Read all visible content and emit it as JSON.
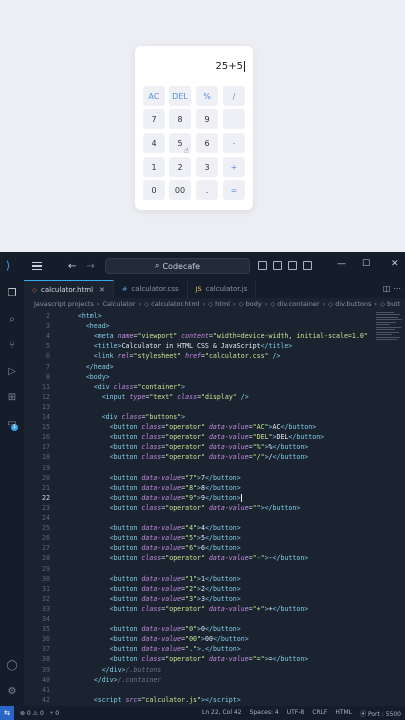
{
  "preview": {
    "display_value": "25+5",
    "buttons": [
      {
        "label": "AC",
        "op": true
      },
      {
        "label": "DEL",
        "op": true
      },
      {
        "label": "%",
        "op": true
      },
      {
        "label": "/",
        "op": true
      },
      {
        "label": "7",
        "op": false
      },
      {
        "label": "8",
        "op": false
      },
      {
        "label": "9",
        "op": false
      },
      {
        "label": "",
        "op": true
      },
      {
        "label": "4",
        "op": false
      },
      {
        "label": "5",
        "op": false
      },
      {
        "label": "6",
        "op": false
      },
      {
        "label": "-",
        "op": true
      },
      {
        "label": "1",
        "op": false
      },
      {
        "label": "2",
        "op": false
      },
      {
        "label": "3",
        "op": false
      },
      {
        "label": "+",
        "op": true
      },
      {
        "label": "0",
        "op": false
      },
      {
        "label": "00",
        "op": false
      },
      {
        "label": ".",
        "op": false
      },
      {
        "label": "=",
        "op": true
      }
    ]
  },
  "titlebar": {
    "search_text": "Codecafe",
    "minimize": "—",
    "maximize": "☐",
    "close": "✕"
  },
  "tabs": [
    {
      "label": "calculator.html",
      "icon": "◇",
      "kind": "html",
      "active": true
    },
    {
      "label": "calculator.css",
      "icon": "#",
      "kind": "css",
      "active": false
    },
    {
      "label": "calculator.js",
      "icon": "JS",
      "kind": "js",
      "active": false
    }
  ],
  "breadcrumb": [
    "Javascript projects",
    "›",
    "Calculator",
    "›",
    "◇ calculator.html",
    "›",
    "◇ html",
    "›",
    "◇ body",
    "›",
    "◇ div.container",
    "›",
    "◇ div.buttons",
    "›",
    "◇ butt"
  ],
  "editor": {
    "current_line": 22,
    "lines": [
      {
        "n": "2",
        "html": "    <span class='tag'>&lt;html&gt;</span>"
      },
      {
        "n": "3",
        "html": "      <span class='tag'>&lt;head&gt;</span>"
      },
      {
        "n": "4",
        "html": "        <span class='tag'>&lt;meta</span> <span class='attr'>name</span>=<span class='str'>\"viewport\"</span> <span class='attr'>content</span>=<span class='str'>\"width=device-width, initial-scale=1.0\"</span>"
      },
      {
        "n": "5",
        "html": "        <span class='tag'>&lt;title&gt;</span><span class='txt'>Calculator in HTML CSS &amp; JavaScript</span><span class='tag'>&lt;/title&gt;</span>"
      },
      {
        "n": "6",
        "html": "        <span class='tag'>&lt;link</span> <span class='attr'>rel</span>=<span class='str'>\"stylesheet\"</span> <span class='attr'>href</span>=<span class='str'>\"calculator.css\"</span> <span class='tag'>/&gt;</span>"
      },
      {
        "n": "7",
        "html": "      <span class='tag'>&lt;/head&gt;</span>"
      },
      {
        "n": "8",
        "html": "      <span class='tag'>&lt;body&gt;</span>"
      },
      {
        "n": "11",
        "html": "        <span class='tag'>&lt;div</span> <span class='attr'>class</span>=<span class='str'>\"container\"</span><span class='tag'>&gt;</span>"
      },
      {
        "n": "12",
        "html": "          <span class='tag'>&lt;input</span> <span class='attr'>type</span>=<span class='str'>\"text\"</span> <span class='attr'>class</span>=<span class='str'>\"display\"</span> <span class='tag'>/&gt;</span>"
      },
      {
        "n": "13",
        "html": ""
      },
      {
        "n": "14",
        "html": "          <span class='tag'>&lt;div</span> <span class='attr'>class</span>=<span class='str'>\"buttons\"</span><span class='tag'>&gt;</span>"
      },
      {
        "n": "15",
        "html": "            <span class='tag'>&lt;button</span> <span class='attr'>class</span>=<span class='str'>\"operator\"</span> <span class='attr'>data-value</span>=<span class='str'>\"AC\"</span><span class='tag'>&gt;</span><span class='txt'>AC</span><span class='tag'>&lt;/button&gt;</span>"
      },
      {
        "n": "16",
        "html": "            <span class='tag'>&lt;button</span> <span class='attr'>class</span>=<span class='str'>\"operator\"</span> <span class='attr'>data-value</span>=<span class='str'>\"DEL\"</span><span class='tag'>&gt;</span><span class='txt'>DEL</span><span class='tag'>&lt;/button&gt;</span>"
      },
      {
        "n": "17",
        "html": "            <span class='tag'>&lt;button</span> <span class='attr'>class</span>=<span class='str'>\"operator\"</span> <span class='attr'>data-value</span>=<span class='str'>\"%\"</span><span class='tag'>&gt;</span><span class='txt'>%</span><span class='tag'>&lt;/button&gt;</span>"
      },
      {
        "n": "18",
        "html": "            <span class='tag'>&lt;button</span> <span class='attr'>class</span>=<span class='str'>\"operator\"</span> <span class='attr'>data-value</span>=<span class='str'>\"/\"</span><span class='tag'>&gt;</span><span class='txt'>/</span><span class='tag'>&lt;/button&gt;</span>"
      },
      {
        "n": "19",
        "html": ""
      },
      {
        "n": "20",
        "html": "            <span class='tag'>&lt;button</span> <span class='attr'>data-value</span>=<span class='str'>\"7\"</span><span class='tag'>&gt;</span><span class='txt'>7</span><span class='tag'>&lt;/button&gt;</span>"
      },
      {
        "n": "21",
        "html": "            <span class='tag'>&lt;button</span> <span class='attr'>data-value</span>=<span class='str'>\"8\"</span><span class='tag'>&gt;</span><span class='txt'>8</span><span class='tag'>&lt;/button&gt;</span>"
      },
      {
        "n": "22",
        "html": "            <span class='tag'>&lt;button</span> <span class='attr'>data-value</span>=<span class='str'>\"9\"</span><span class='tag'>&gt;</span><span class='txt'>9</span><span class='tag'>&lt;/button&gt;</span><span class='caret-line'></span>"
      },
      {
        "n": "23",
        "html": "            <span class='tag'>&lt;button</span> <span class='attr'>class</span>=<span class='str'>\"operator\"</span> <span class='attr'>data-value</span>=<span class='str'>\"\"</span><span class='tag'>&gt;&lt;/button&gt;</span>"
      },
      {
        "n": "24",
        "html": ""
      },
      {
        "n": "25",
        "html": "            <span class='tag'>&lt;button</span> <span class='attr'>data-value</span>=<span class='str'>\"4\"</span><span class='tag'>&gt;</span><span class='txt'>4</span><span class='tag'>&lt;/button&gt;</span>"
      },
      {
        "n": "26",
        "html": "            <span class='tag'>&lt;button</span> <span class='attr'>data-value</span>=<span class='str'>\"5\"</span><span class='tag'>&gt;</span><span class='txt'>5</span><span class='tag'>&lt;/button&gt;</span>"
      },
      {
        "n": "27",
        "html": "            <span class='tag'>&lt;button</span> <span class='attr'>data-value</span>=<span class='str'>\"6\"</span><span class='tag'>&gt;</span><span class='txt'>6</span><span class='tag'>&lt;/button&gt;</span>"
      },
      {
        "n": "28",
        "html": "            <span class='tag'>&lt;button</span> <span class='attr'>class</span>=<span class='str'>\"operator\"</span> <span class='attr'>data-value</span>=<span class='str'>\"-\"</span><span class='tag'>&gt;</span><span class='txt'>-</span><span class='tag'>&lt;/button&gt;</span>"
      },
      {
        "n": "29",
        "html": ""
      },
      {
        "n": "30",
        "html": "            <span class='tag'>&lt;button</span> <span class='attr'>data-value</span>=<span class='str'>\"1\"</span><span class='tag'>&gt;</span><span class='txt'>1</span><span class='tag'>&lt;/button&gt;</span>"
      },
      {
        "n": "31",
        "html": "            <span class='tag'>&lt;button</span> <span class='attr'>data-value</span>=<span class='str'>\"2\"</span><span class='tag'>&gt;</span><span class='txt'>2</span><span class='tag'>&lt;/button&gt;</span>"
      },
      {
        "n": "32",
        "html": "            <span class='tag'>&lt;button</span> <span class='attr'>data-value</span>=<span class='str'>\"3\"</span><span class='tag'>&gt;</span><span class='txt'>3</span><span class='tag'>&lt;/button&gt;</span>"
      },
      {
        "n": "33",
        "html": "            <span class='tag'>&lt;button</span> <span class='attr'>class</span>=<span class='str'>\"operator\"</span> <span class='attr'>data-value</span>=<span class='str'>\"+\"</span><span class='tag'>&gt;</span><span class='txt'>+</span><span class='tag'>&lt;/button&gt;</span>"
      },
      {
        "n": "34",
        "html": ""
      },
      {
        "n": "35",
        "html": "            <span class='tag'>&lt;button</span> <span class='attr'>data-value</span>=<span class='str'>\"0\"</span><span class='tag'>&gt;</span><span class='txt'>0</span><span class='tag'>&lt;/button&gt;</span>"
      },
      {
        "n": "36",
        "html": "            <span class='tag'>&lt;button</span> <span class='attr'>data-value</span>=<span class='str'>\"00\"</span><span class='tag'>&gt;</span><span class='txt'>00</span><span class='tag'>&lt;/button&gt;</span>"
      },
      {
        "n": "37",
        "html": "            <span class='tag'>&lt;button</span> <span class='attr'>data-value</span>=<span class='str'>\".\"</span><span class='tag'>&gt;</span><span class='txt'>.</span><span class='tag'>&lt;/button&gt;</span>"
      },
      {
        "n": "38",
        "html": "            <span class='tag'>&lt;button</span> <span class='attr'>class</span>=<span class='str'>\"operator\"</span> <span class='attr'>data-value</span>=<span class='str'>\"=\"</span><span class='tag'>&gt;</span><span class='txt'>=</span><span class='tag'>&lt;/button&gt;</span>"
      },
      {
        "n": "39",
        "html": "          <span class='tag'>&lt;/div&gt;</span><span class='cmt'>/.buttons</span>"
      },
      {
        "n": "40",
        "html": "        <span class='tag'>&lt;/div&gt;</span><span class='cmt'>/.container</span>"
      },
      {
        "n": "41",
        "html": ""
      },
      {
        "n": "42",
        "html": "        <span class='tag'>&lt;script</span> <span class='attr'>src</span>=<span class='str'>\"calculator.js\"</span><span class='tag'>&gt;&lt;/script&gt;</span>"
      }
    ]
  },
  "statusbar": {
    "errors": "⊗ 0 ⚠ 0",
    "ports": "⑂ 0",
    "position": "Ln 22, Col 42",
    "spaces": "Spaces: 4",
    "encoding": "UTF-8",
    "eol": "CRLF",
    "language": "HTML",
    "port": "⦿ Port : 5500"
  }
}
